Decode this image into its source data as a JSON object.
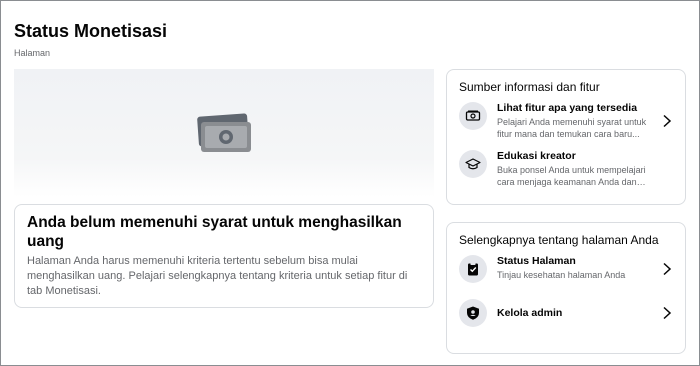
{
  "page": {
    "title": "Status Monetisasi",
    "subtitle": "Halaman"
  },
  "notice": {
    "title": "Anda belum memenuhi syarat untuk menghasilkan uang",
    "body": "Halaman Anda harus memenuhi kriteria tertentu sebelum bisa mulai menghasilkan uang. Pelajari selengkapnya tentang kriteria untuk setiap fitur di tab Monetisasi."
  },
  "resources": {
    "heading": "Sumber informasi dan fitur",
    "items": [
      {
        "title": "Lihat fitur apa yang tersedia",
        "desc": "Pelajari Anda memenuhi syarat untuk fitur mana dan temukan cara baru...",
        "icon": "money-check-icon"
      },
      {
        "title": "Edukasi kreator",
        "desc": "Buka ponsel Anda untuk mempelajari cara menjaga keamanan Anda dan pemirsa...",
        "icon": "graduation-cap-icon"
      }
    ]
  },
  "more": {
    "heading": "Selengkapnya tentang halaman Anda",
    "items": [
      {
        "title": "Status Halaman",
        "desc": "Tinjau kesehatan halaman Anda",
        "icon": "clipboard-check-icon"
      },
      {
        "title": "Kelola admin",
        "desc": "",
        "icon": "shield-icon"
      }
    ]
  },
  "colors": {
    "text_primary": "#050505",
    "text_secondary": "#65676b",
    "icon_bg": "#e4e6eb",
    "border": "#dadde1"
  }
}
